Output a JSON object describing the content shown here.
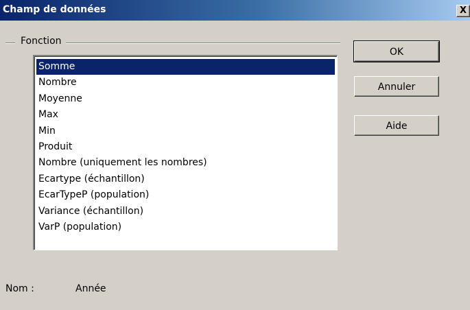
{
  "window": {
    "title": "Champ de données",
    "close_label": "X"
  },
  "function_group": {
    "label": "Fonction",
    "items": [
      {
        "label": "Somme",
        "selected": true
      },
      {
        "label": "Nombre",
        "selected": false
      },
      {
        "label": "Moyenne",
        "selected": false
      },
      {
        "label": "Max",
        "selected": false
      },
      {
        "label": "Min",
        "selected": false
      },
      {
        "label": "Produit",
        "selected": false
      },
      {
        "label": "Nombre (uniquement les nombres)",
        "selected": false
      },
      {
        "label": "Ecartype (échantillon)",
        "selected": false
      },
      {
        "label": "EcarTypeP (population)",
        "selected": false
      },
      {
        "label": "Variance (échantillon)",
        "selected": false
      },
      {
        "label": "VarP (population)",
        "selected": false
      }
    ]
  },
  "buttons": {
    "ok": "OK",
    "cancel": "Annuler",
    "help": "Aide"
  },
  "name_field": {
    "label": "Nom :",
    "value": "Année"
  }
}
